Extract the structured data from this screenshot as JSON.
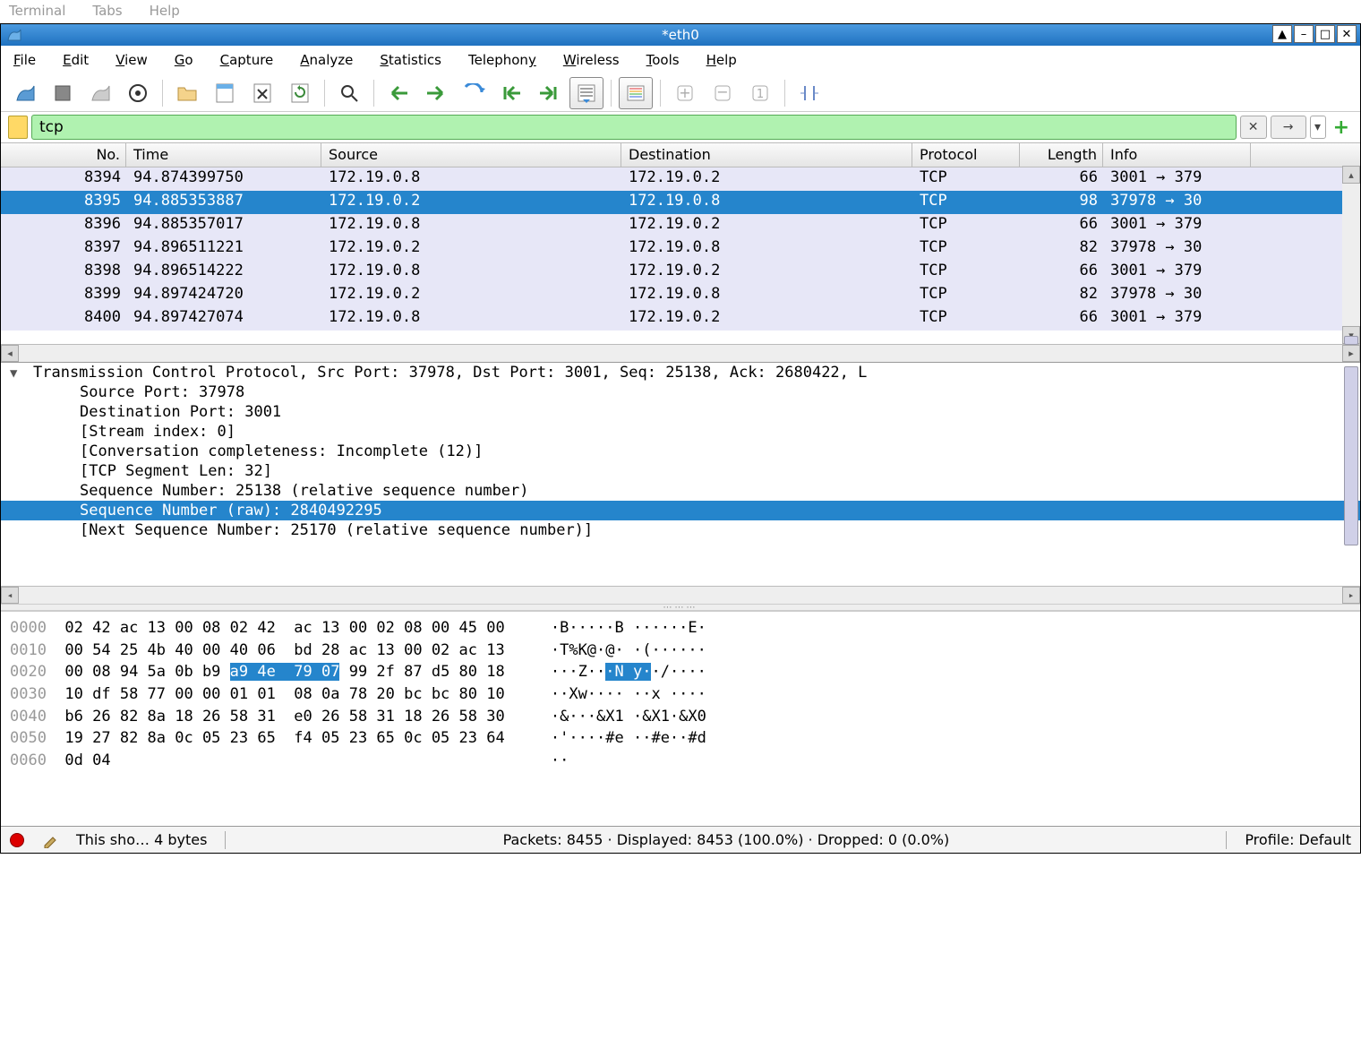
{
  "topmenu": [
    "Terminal",
    "Tabs",
    "Help"
  ],
  "window": {
    "title": "*eth0"
  },
  "menu": [
    "File",
    "Edit",
    "View",
    "Go",
    "Capture",
    "Analyze",
    "Statistics",
    "Telephony",
    "Wireless",
    "Tools",
    "Help"
  ],
  "filter": {
    "value": "tcp"
  },
  "packet_headers": [
    "No.",
    "Time",
    "Source",
    "Destination",
    "Protocol",
    "Length",
    "Info"
  ],
  "packets": [
    {
      "no": "8394",
      "time": "94.874399750",
      "src": "172.19.0.8",
      "dst": "172.19.0.2",
      "proto": "TCP",
      "len": "66",
      "info": "3001 → 379"
    },
    {
      "no": "8395",
      "time": "94.885353887",
      "src": "172.19.0.2",
      "dst": "172.19.0.8",
      "proto": "TCP",
      "len": "98",
      "info": "37978 → 30",
      "selected": true
    },
    {
      "no": "8396",
      "time": "94.885357017",
      "src": "172.19.0.8",
      "dst": "172.19.0.2",
      "proto": "TCP",
      "len": "66",
      "info": "3001 → 379"
    },
    {
      "no": "8397",
      "time": "94.896511221",
      "src": "172.19.0.2",
      "dst": "172.19.0.8",
      "proto": "TCP",
      "len": "82",
      "info": "37978 → 30"
    },
    {
      "no": "8398",
      "time": "94.896514222",
      "src": "172.19.0.8",
      "dst": "172.19.0.2",
      "proto": "TCP",
      "len": "66",
      "info": "3001 → 379"
    },
    {
      "no": "8399",
      "time": "94.897424720",
      "src": "172.19.0.2",
      "dst": "172.19.0.8",
      "proto": "TCP",
      "len": "82",
      "info": "37978 → 30"
    },
    {
      "no": "8400",
      "time": "94.897427074",
      "src": "172.19.0.8",
      "dst": "172.19.0.2",
      "proto": "TCP",
      "len": "66",
      "info": "3001 → 379"
    }
  ],
  "details": {
    "header": "Transmission Control Protocol, Src Port: 37978, Dst Port: 3001, Seq: 25138, Ack: 2680422, L",
    "lines": [
      "Source Port: 37978",
      "Destination Port: 3001",
      "[Stream index: 0]",
      "[Conversation completeness: Incomplete (12)]",
      "[TCP Segment Len: 32]",
      "Sequence Number: 25138    (relative sequence number)",
      "Sequence Number (raw): 2840492295",
      "[Next Sequence Number: 25170    (relative sequence number)]"
    ],
    "selected_index": 6
  },
  "hex": [
    {
      "off": "0000",
      "b": "02 42 ac 13 00 08 02 42  ac 13 00 02 08 00 45 00",
      "a": "·B·····B ······E·"
    },
    {
      "off": "0010",
      "b": "00 54 25 4b 40 00 40 06  bd 28 ac 13 00 02 ac 13",
      "a": "·T%K@·@· ·(······"
    },
    {
      "off": "0020",
      "pre": "00 08 94 5a 0b b9 ",
      "hl": "a9 4e  79 07",
      "post": " 99 2f 87 d5 80 18",
      "a_pre": "···Z··",
      "a_hl": "·N y·",
      "a_post": "·/····"
    },
    {
      "off": "0030",
      "b": "10 df 58 77 00 00 01 01  08 0a 78 20 bc bc 80 10",
      "a": "··Xw···· ··x ····"
    },
    {
      "off": "0040",
      "b": "b6 26 82 8a 18 26 58 31  e0 26 58 31 18 26 58 30",
      "a": "·&···&X1 ·&X1·&X0"
    },
    {
      "off": "0050",
      "b": "19 27 82 8a 0c 05 23 65  f4 05 23 65 0c 05 23 64",
      "a": "·'····#e ··#e··#d"
    },
    {
      "off": "0060",
      "b": "0d 04",
      "a": "··"
    }
  ],
  "status": {
    "left": "This sho… 4 bytes",
    "mid": "Packets: 8455 · Displayed: 8453 (100.0%) · Dropped: 0 (0.0%)",
    "right": "Profile: Default"
  }
}
